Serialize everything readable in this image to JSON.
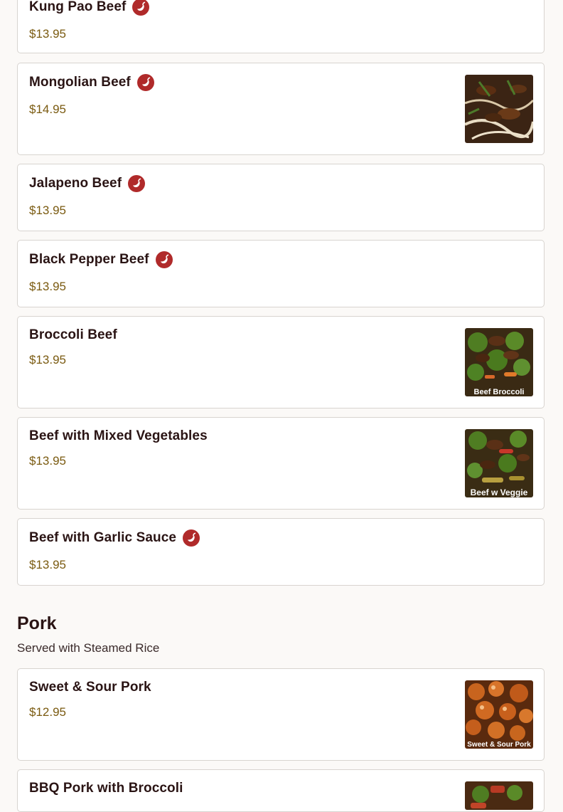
{
  "items": [
    {
      "name": "Kung Pao Beef",
      "price": "$13.95",
      "spicy": true
    },
    {
      "name": "Mongolian Beef",
      "price": "$14.95",
      "spicy": true,
      "image": "mongolian-beef-photo"
    },
    {
      "name": "Jalapeno Beef",
      "price": "$13.95",
      "spicy": true
    },
    {
      "name": "Black Pepper Beef",
      "price": "$13.95",
      "spicy": true
    },
    {
      "name": "Broccoli Beef",
      "price": "$13.95",
      "spicy": false,
      "image": "broccoli-beef-photo",
      "image_caption": "Beef Broccoli"
    },
    {
      "name": "Beef with Mixed Vegetables",
      "price": "$13.95",
      "spicy": false,
      "image": "beef-veggie-photo",
      "image_caption": "Beef w Veggie"
    },
    {
      "name": "Beef with Garlic Sauce",
      "price": "$13.95",
      "spicy": true
    }
  ],
  "pork_section": {
    "title": "Pork",
    "subtitle": "Served with Steamed Rice",
    "items": [
      {
        "name": "Sweet & Sour Pork",
        "price": "$12.95",
        "spicy": false,
        "image": "sweet-sour-pork-photo",
        "image_caption": "Sweet & Sour Pork"
      },
      {
        "name": "BBQ Pork with Broccoli",
        "price": "",
        "spicy": false,
        "image": "bbq-pork-photo"
      }
    ]
  },
  "colors": {
    "background": "#fbf9f7",
    "card_border": "#d8d4d0",
    "price": "#7a5a10",
    "spicy_icon": "#b02a2a",
    "text": "#2a1414"
  },
  "icons": {
    "spicy": "chili-pepper-icon"
  }
}
